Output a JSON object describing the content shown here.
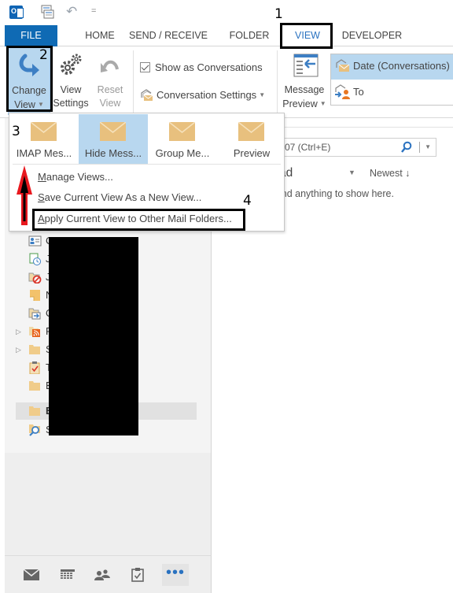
{
  "quick_access": {
    "icons": [
      "outlook-app-icon",
      "send-receive-all-icon",
      "undo-icon",
      "customize-qat-icon"
    ],
    "customize_glyph": "="
  },
  "tabs": [
    {
      "label": "FILE",
      "active": false
    },
    {
      "label": "HOME",
      "active": false
    },
    {
      "label": "SEND / RECEIVE",
      "active": false
    },
    {
      "label": "FOLDER",
      "active": false
    },
    {
      "label": "VIEW",
      "active": true
    },
    {
      "label": "DEVELOPER",
      "active": false
    }
  ],
  "ribbon": {
    "change_view": {
      "line1": "Change",
      "line2": "View",
      "icon": "change-view-arrow-icon"
    },
    "view_settings": {
      "line1": "View",
      "line2": "Settings",
      "icon": "gears-icon"
    },
    "reset_view": {
      "line1": "Reset",
      "line2": "View",
      "icon": "reset-undo-icon"
    },
    "show_as_conversations": {
      "label": "Show as Conversations",
      "checked": true
    },
    "conversation_settings": {
      "label": "Conversation Settings"
    },
    "message_preview": {
      "line1": "Message",
      "line2": "Preview"
    },
    "arrangement": {
      "items": [
        {
          "label": "Date (Conversations)",
          "selected": true
        },
        {
          "label": "To",
          "selected": false
        }
      ]
    }
  },
  "change_view_menu": {
    "gallery": [
      {
        "label": "IMAP Mes...",
        "active": false
      },
      {
        "label": "Hide Mess...",
        "active": true
      },
      {
        "label": "Group Me...",
        "active": false
      },
      {
        "label": "Preview",
        "active": false
      }
    ],
    "items": [
      {
        "label": "Manage Views...",
        "accel": "M"
      },
      {
        "label": "Save Current View As a New View...",
        "accel": "S"
      },
      {
        "label": "Apply Current View to Other Mail Folders...",
        "accel": "A"
      }
    ]
  },
  "folders": [
    {
      "label": "C",
      "icon": "contacts-icon",
      "expandable": false,
      "selected": false
    },
    {
      "label": "Jo",
      "icon": "journal-icon",
      "expandable": false,
      "selected": false
    },
    {
      "label": "Ju",
      "icon": "junk-email-icon",
      "expandable": false,
      "selected": false
    },
    {
      "label": "N",
      "icon": "notes-icon",
      "expandable": false,
      "selected": false
    },
    {
      "label": "O",
      "icon": "outbox-icon",
      "expandable": false,
      "selected": false
    },
    {
      "label": "R",
      "icon": "rss-feeds-icon",
      "expandable": true,
      "selected": false
    },
    {
      "label": "Sy",
      "icon": "folder-icon",
      "expandable": true,
      "selected": false
    },
    {
      "label": "T",
      "icon": "tasks-icon",
      "expandable": false,
      "selected": false
    },
    {
      "label": "El",
      "icon": "folder-icon",
      "expandable": false,
      "selected": false
    },
    {
      "label": "Ex",
      "icon": "folder-icon",
      "expandable": false,
      "selected": true
    },
    {
      "label": "Se",
      "icon": "search-folder-icon",
      "expandable": false,
      "selected": false
    }
  ],
  "nav_bar": [
    {
      "name": "mail-icon"
    },
    {
      "name": "calendar-icon"
    },
    {
      "name": "people-icon"
    },
    {
      "name": "tasks-icon"
    },
    {
      "name": "more-icon",
      "glyph": "•••"
    }
  ],
  "message_list": {
    "search_placeholder": "07 (Ctrl+E)",
    "header": "ad",
    "sort_label": "Newest",
    "sort_arrow": "↓",
    "empty_text": "ind anything to show here."
  },
  "annotations": [
    {
      "number": "1",
      "target": "VIEW tab"
    },
    {
      "number": "2",
      "target": "Change View button"
    },
    {
      "number": "3",
      "target": "view gallery"
    },
    {
      "number": "4",
      "target": "Apply Current View to Other Mail Folders"
    }
  ],
  "colors": {
    "accent_blue": "#0f6ab4",
    "selected_blue": "#b8d7ef",
    "envelope": "#e8c07e",
    "annotation_arrow": "#e8181e"
  }
}
